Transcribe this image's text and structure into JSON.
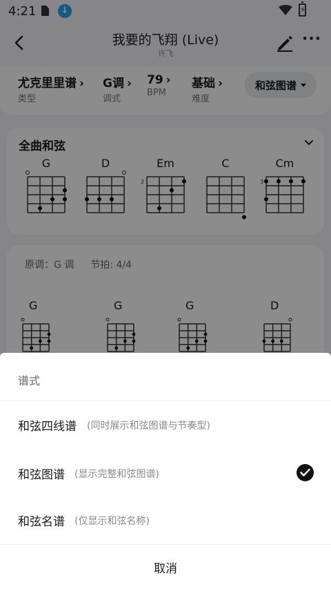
{
  "status_bar": {
    "time": "4:21",
    "battery_glyph": "⚡"
  },
  "nav": {
    "title": "我要的飞翔 (Live)",
    "artist": "许飞"
  },
  "info": {
    "type": {
      "value": "尤克里里谱",
      "label": "类型"
    },
    "key": {
      "value": "G调",
      "label": "调式"
    },
    "bpm": {
      "value": "79",
      "label": "BPM"
    },
    "level": {
      "value": "基础",
      "label": "难度"
    },
    "chart_type_button": "和弦图谱",
    "chevron": "›",
    "accent_color": "#1f6fd1"
  },
  "chords_card": {
    "title": "全曲和弦",
    "chords": [
      {
        "name": "G",
        "start_fret": "",
        "open_strings": [
          0
        ],
        "dots": [
          [
            2,
            2
          ],
          [
            3,
            1
          ],
          [
            2,
            3
          ],
          [
            1,
            3
          ]
        ]
      },
      {
        "name": "D",
        "start_fret": "",
        "open_strings": [
          3
        ],
        "dots": [
          [
            2,
            0
          ],
          [
            2,
            1
          ],
          [
            2,
            2
          ]
        ]
      },
      {
        "name": "Em",
        "start_fret": "2",
        "open_strings": [],
        "dots": [
          [
            0,
            3
          ],
          [
            1,
            2
          ],
          [
            3,
            1
          ]
        ]
      },
      {
        "name": "C",
        "start_fret": "",
        "open_strings": [],
        "dots": [
          [
            4,
            3
          ]
        ]
      },
      {
        "name": "Cm",
        "start_fret": "3",
        "open_strings": [],
        "dots": [
          [
            0,
            0
          ],
          [
            0,
            1
          ],
          [
            0,
            2
          ],
          [
            0,
            3
          ],
          [
            2,
            0
          ]
        ]
      }
    ]
  },
  "sheet": {
    "original_key": "原调：G 调",
    "time_signature": "节拍: 4/4",
    "chords": [
      "G",
      "G",
      "G",
      "D"
    ]
  },
  "bottom_sheet": {
    "header": "谱式",
    "options": [
      {
        "label": "和弦四线谱",
        "desc": "(同时展示和弦图谱与节奏型)",
        "selected": false
      },
      {
        "label": "和弦图谱",
        "desc": "(显示完整和弦图谱)",
        "selected": true
      },
      {
        "label": "和弦名谱",
        "desc": "(仅显示和弦名称)",
        "selected": false
      }
    ],
    "cancel": "取消"
  }
}
